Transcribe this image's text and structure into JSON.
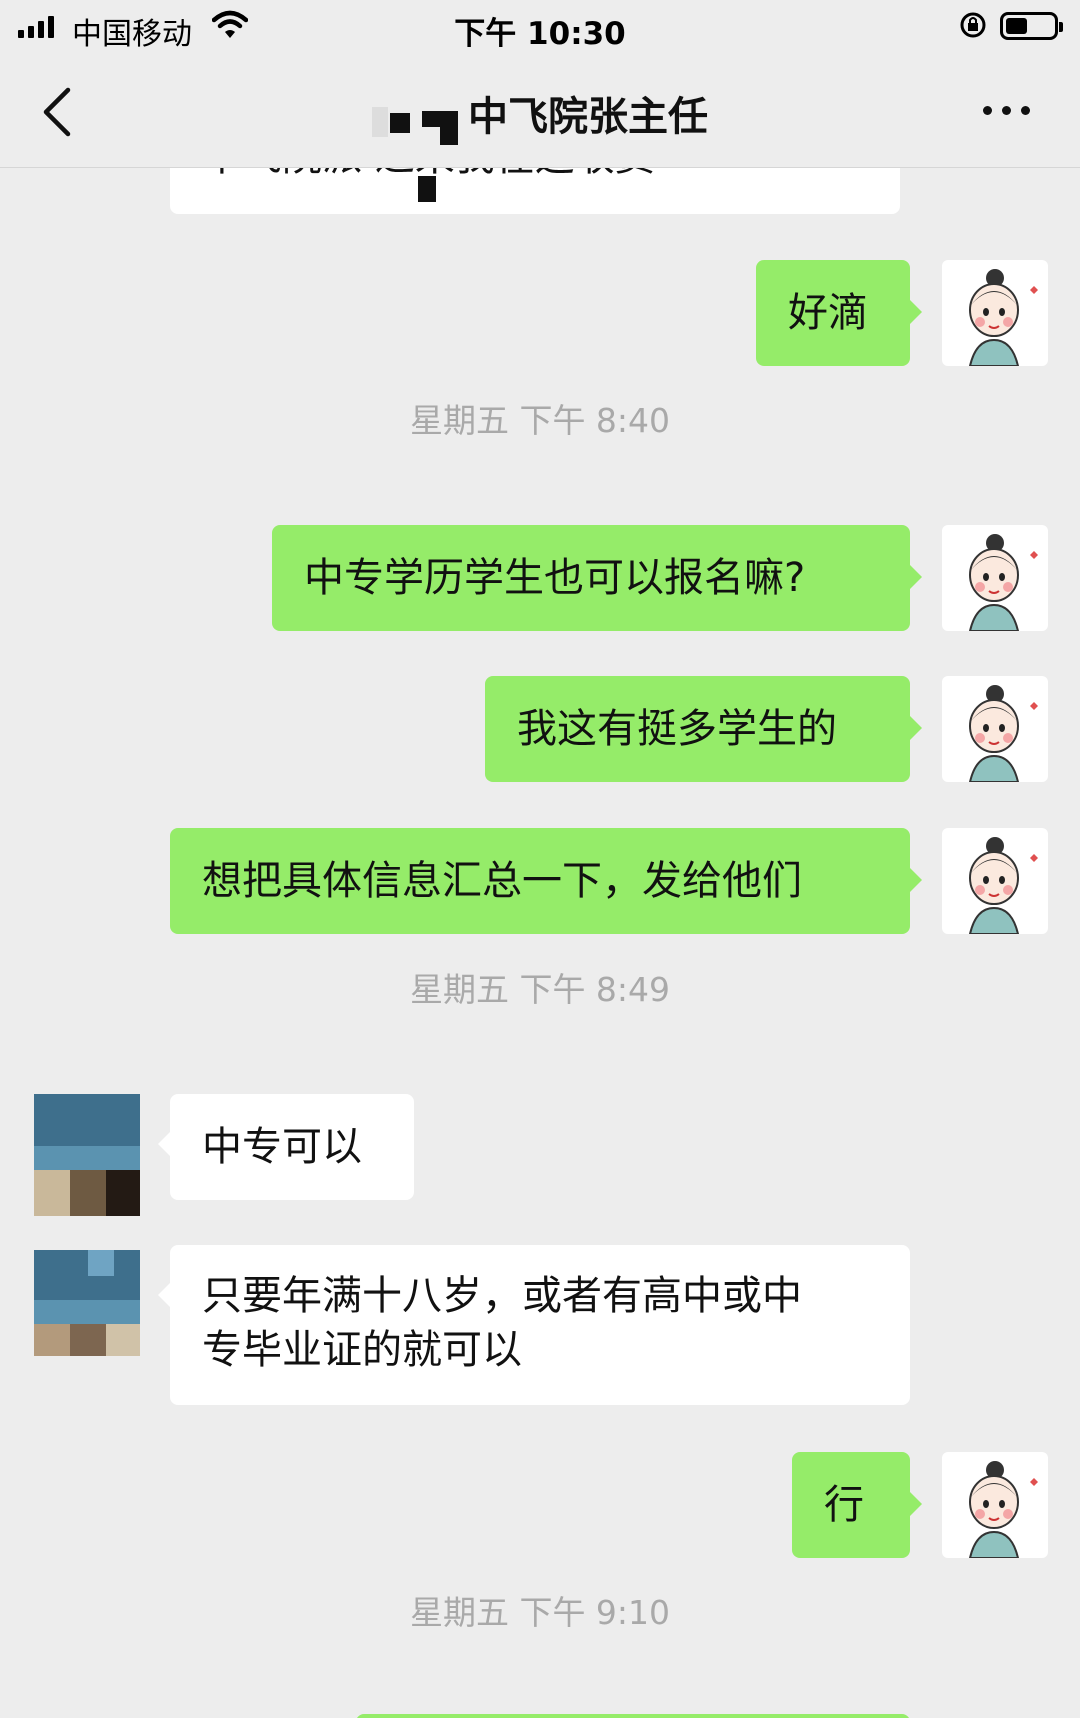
{
  "status_bar": {
    "carrier": "中国移动",
    "time": "下午 10:30",
    "battery_level": 0.45
  },
  "nav": {
    "title": "中飞院张主任"
  },
  "messages": {
    "m0_text": "中飞院派   过来我在这收费",
    "m1_text": "好滴",
    "ts1": "星期五 下午 8:40",
    "m2_text": "中专学历学生也可以报名嘛?",
    "m3_text": "我这有挺多学生的",
    "m4_text": "想把具体信息汇总一下，发给他们",
    "ts2": "星期五 下午 8:49",
    "m5_text": "中专可以",
    "m6_line1": "只要年满十八岁，或者有高中或中",
    "m6_line2": "专毕业证的就可以",
    "m7_text": "行",
    "ts3": "星期五 下午 9:10"
  },
  "colors": {
    "background": "#ededed",
    "my_bubble": "#95ec69",
    "their_bubble": "#ffffff",
    "timestamp_text": "#a9a9a9"
  },
  "icons": [
    "signal-icon",
    "wifi-icon",
    "rotation-lock-icon",
    "battery-icon",
    "back-chevron-icon",
    "more-dots-icon"
  ]
}
